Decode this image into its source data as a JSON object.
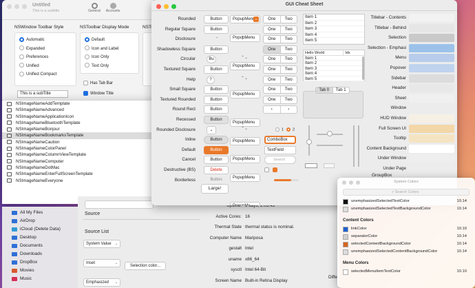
{
  "back_window": {
    "title": "Untitled",
    "subtitle": "This is a subtitle",
    "toolbar_items": [
      "General",
      "Accounts"
    ],
    "group1_title": "NSWindow Toolbar Style",
    "group1_options": [
      "Automatic",
      "Expanded",
      "Preferences",
      "Unified",
      "Unified Compact"
    ],
    "group2_title": "NSToolbar Display Mode",
    "group2_options": [
      "Default",
      "Icon and Label",
      "Icon Only",
      "Text Only"
    ],
    "group3_title": "NSTo",
    "has_tab_bar": "Has Tab Bar",
    "window_title": "Window Title",
    "subtitle_field": "This is a subTitle"
  },
  "image_list": [
    "NSImageNameAddTemplate",
    "NSImageNameAdvanced",
    "NSImageNameApplicationIcon",
    "NSImageNameBluetoothTemplate",
    "NSImageNameBonjour",
    "NSImageNameBookmarksTemplate",
    "NSImageNameCaution",
    "NSImageNameColorPanel",
    "NSImageNameColumnViewTemplate",
    "NSImageNameComputer",
    "NSImageNameDotMac",
    "NSImageNameEnterFullScreenTemplate",
    "NSImageNameEveryone"
  ],
  "finder_sidebar": [
    "All My Files",
    "AirDrop",
    "iCloud (Delete Data)",
    "Desktop",
    "Documents",
    "Downloads",
    "DropBox",
    "Movies",
    "Music"
  ],
  "source": {
    "title": "Source",
    "list_title": "Source List",
    "popup1": "System Value",
    "popup2": "Inset",
    "popup3": "Emphasized",
    "selection_btn": "Selection color..."
  },
  "sysinfo": {
    "rows": [
      {
        "k": "Uptime:",
        "v": "2 days, 2:03:43"
      },
      {
        "k": "Active Cores:",
        "v": "16"
      },
      {
        "k": "Thermal State",
        "v": "thermal status is nominal."
      },
      {
        "k": "Computer Name",
        "v": "Mariposa"
      },
      {
        "k": "gestalt",
        "v": "Intel"
      },
      {
        "k": "uname",
        "v": "x86_64"
      },
      {
        "k": "sysctl",
        "v": "Intel 64-Bit"
      },
      {
        "k": "Screen Name",
        "v": "Built-in Retina Display"
      }
    ],
    "diff_label": "Diffe"
  },
  "cheat": {
    "title": "GUI Cheat Sheet",
    "labels": [
      "Rounded",
      "Regular Square",
      "Disclosure",
      "Shadowless Square",
      "Circular",
      "Textured Square",
      "Help",
      "Small Square",
      "Textured Rounded",
      "Round Rect",
      "Recessed",
      "Rounded Disclosure",
      "Inline",
      "Default",
      "Cancel",
      "Destructive (BS)",
      "Borderless"
    ],
    "button": "Button",
    "popup": "PopupMenu",
    "popup_short": "PopupMe",
    "one": "One",
    "two": "Two",
    "circular_btn": "Bu",
    "help_q": "?",
    "default_btn": "Button",
    "destructive_btn": "Delete",
    "large_btn": "Large!",
    "combobox": "ComboBox",
    "textfield": "TextField",
    "search_ph": "Search",
    "list_items": [
      "Item 1",
      "Item 2",
      "Item 3",
      "Item 4",
      "Item 5"
    ],
    "table_header": [
      "Hello World",
      "Idx"
    ],
    "tabs": [
      "Tab 0",
      "Tab 1"
    ],
    "radio_labels": [
      "1",
      "2"
    ]
  },
  "colors_right": {
    "labels": [
      "Titlebar - Contents",
      "Titlebar - Behind",
      "Selection",
      "Selection - Emphasi",
      "Menu",
      "Popover",
      "Sidebar",
      "Header",
      "Sheet",
      "Window",
      "HUD Window",
      "Full Screen UI",
      "Tooltip",
      "Content Background",
      "Under Window",
      "Under Page"
    ],
    "swatches": [
      "#f2f2f2",
      "#e6e6e6",
      "#c9c9c9",
      "#9cc2ea",
      "#b8cdeb",
      "#c0d3ee",
      "#dcdcdc",
      "#e8e8e8",
      "#f0f0f0",
      "#ececec",
      "#f6f0e4",
      "#f3d7a8",
      "#f5e4c2",
      "#ffffff",
      "#eeeeee",
      "#ededed"
    ],
    "groupbox": "GroupBox"
  },
  "system_colors": {
    "title": "System Colors",
    "search_ph": "Search Colors",
    "items": [
      {
        "name": "unemphasizedSelectedTextColor",
        "ver": "10.14",
        "color": "#111111"
      },
      {
        "name": "unemphasizedSelectedTextBackgroundColor",
        "ver": "10.14",
        "color": "#dcdcdc"
      }
    ],
    "content_title": "Content Colors",
    "content_items": [
      {
        "name": "linkColor",
        "ver": "10.10",
        "color": "#1f5fd1"
      },
      {
        "name": "separatorColor",
        "ver": "10.14",
        "color": "#d0d0d0"
      },
      {
        "name": "selectedContentBackgroundColor",
        "ver": "10.14",
        "color": "#d9651e"
      },
      {
        "name": "unemphasizedSelectedContentBackgroundColor",
        "ver": "10.14",
        "color": "#dcdcdc"
      }
    ],
    "menu_title": "Menu Colors",
    "menu_items": [
      {
        "name": "selectedMenuItemTextColor",
        "ver": "10.10",
        "color": "#ffffff"
      }
    ]
  }
}
